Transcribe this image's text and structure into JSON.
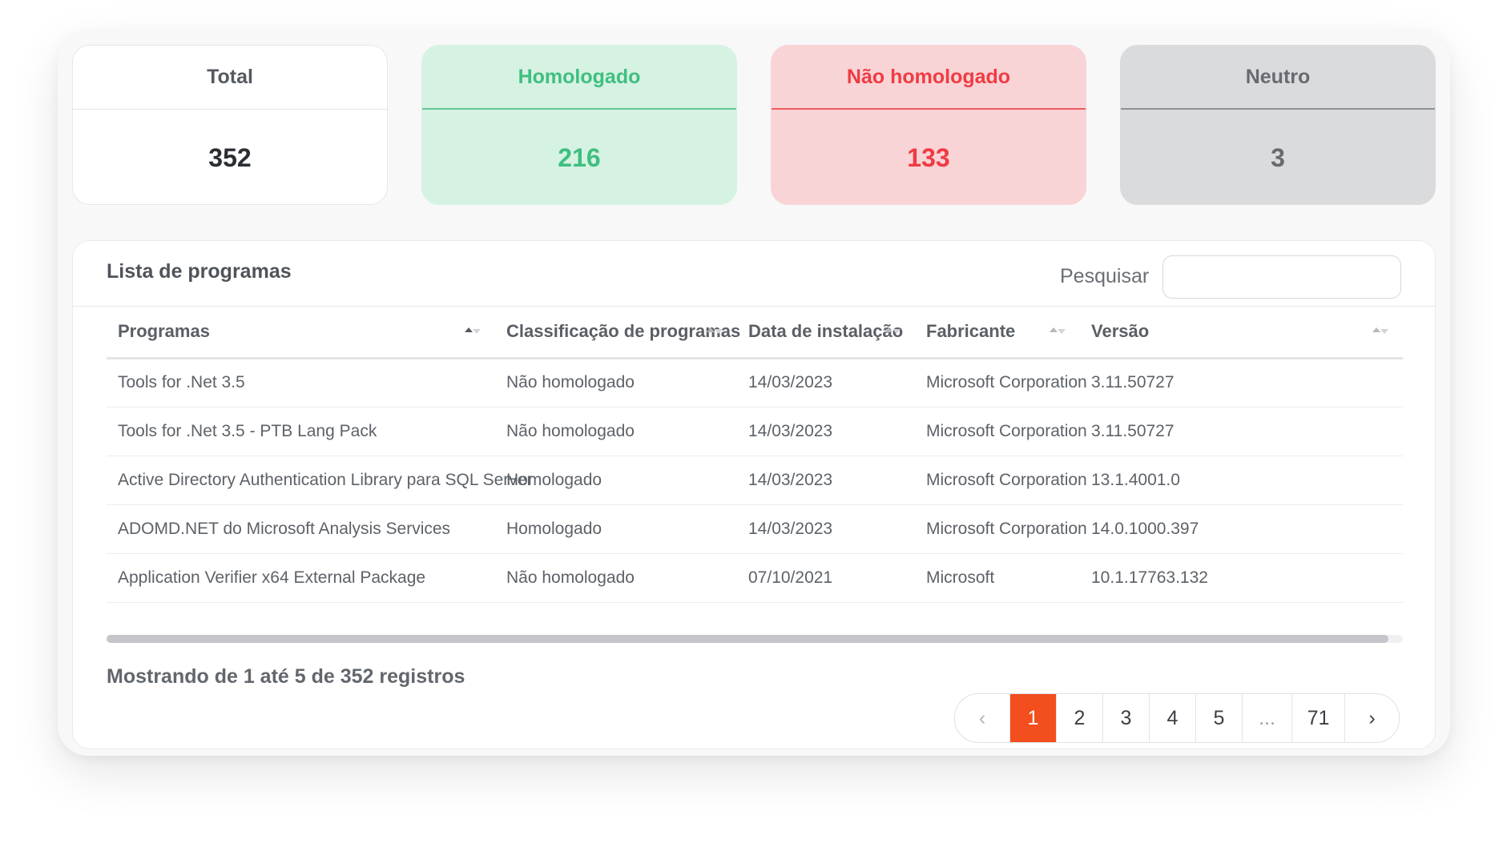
{
  "summary": {
    "total": {
      "label": "Total",
      "value": "352"
    },
    "homologado": {
      "label": "Homologado",
      "value": "216"
    },
    "nao_homologado": {
      "label": "Não homologado",
      "value": "133"
    },
    "neutro": {
      "label": "Neutro",
      "value": "3"
    }
  },
  "panel": {
    "title": "Lista de programas",
    "search_label": "Pesquisar",
    "search_value": ""
  },
  "table": {
    "columns": [
      {
        "label": "Programas",
        "sort": "asc"
      },
      {
        "label": "Classificação de programas",
        "sort": "none"
      },
      {
        "label": "Data de instalação",
        "sort": "none"
      },
      {
        "label": "Fabricante",
        "sort": "none"
      },
      {
        "label": "Versão",
        "sort": "none"
      }
    ],
    "rows": [
      {
        "program": "Tools for .Net 3.5",
        "classification": "Não homologado",
        "date": "14/03/2023",
        "vendor": "Microsoft Corporation",
        "version": "3.11.50727"
      },
      {
        "program": "Tools for .Net 3.5 - PTB Lang Pack",
        "classification": "Não homologado",
        "date": "14/03/2023",
        "vendor": "Microsoft Corporation",
        "version": "3.11.50727"
      },
      {
        "program": "Active Directory Authentication Library para SQL Server",
        "classification": "Homologado",
        "date": "14/03/2023",
        "vendor": "Microsoft Corporation",
        "version": "13.1.4001.0"
      },
      {
        "program": "ADOMD.NET do Microsoft Analysis Services",
        "classification": "Homologado",
        "date": "14/03/2023",
        "vendor": "Microsoft Corporation",
        "version": "14.0.1000.397"
      },
      {
        "program": "Application Verifier x64 External Package",
        "classification": "Não homologado",
        "date": "07/10/2021",
        "vendor": "Microsoft",
        "version": "10.1.17763.132"
      }
    ]
  },
  "info_text": "Mostrando de 1 até 5 de 352 registros",
  "pagination": {
    "prev": "‹",
    "pages": [
      "1",
      "2",
      "3",
      "4",
      "5",
      "...",
      "71"
    ],
    "active": "1",
    "next": "›"
  },
  "colors": {
    "homologado": "#3fbf7f",
    "nao_homologado": "#ef3b43",
    "neutro": "#676b70",
    "accent": "#f24e1e"
  }
}
